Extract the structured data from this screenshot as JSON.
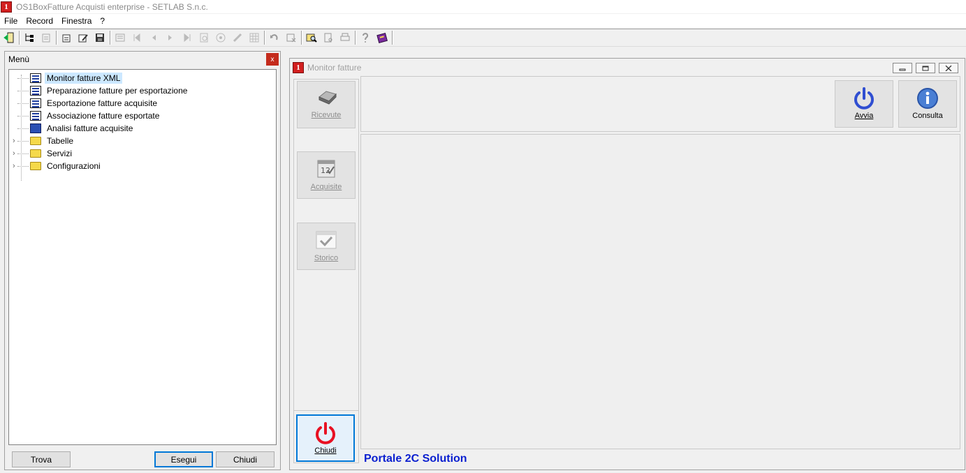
{
  "app": {
    "title": "OS1BoxFatture Acquisti enterprise - SETLAB S.n.c.",
    "icon_glyph": "1"
  },
  "menubar": {
    "items": [
      "File",
      "Record",
      "Finestra",
      "?"
    ]
  },
  "menu_panel": {
    "title": "Menù",
    "close_glyph": "x",
    "tree": [
      {
        "label": "Monitor fatture XML",
        "icon": "form-icon"
      },
      {
        "label": "Preparazione fatture per esportazione",
        "icon": "form-icon"
      },
      {
        "label": "Esportazione fatture acquisite",
        "icon": "form-icon"
      },
      {
        "label": "Associazione fatture esportate",
        "icon": "form-icon"
      },
      {
        "label": "Analisi fatture acquisite",
        "icon": "book-icon"
      },
      {
        "label": "Tabelle",
        "icon": "folder-icon"
      },
      {
        "label": "Servizi",
        "icon": "folder-icon"
      },
      {
        "label": "Configurazioni",
        "icon": "folder-icon"
      }
    ],
    "buttons": {
      "trova": "Trova",
      "esegui": "Esegui",
      "chiudi": "Chiudi"
    }
  },
  "monitor": {
    "title": "Monitor fatture",
    "side": {
      "ricevute": "Ricevute",
      "acquisite": "Acquisite",
      "storico": "Storico",
      "chiudi": "Chiudi"
    },
    "top": {
      "avvia": "Avvia",
      "consulta": "Consulta"
    },
    "footer": "Portale 2C Solution"
  },
  "colors": {
    "accent": "#0078d7",
    "power_red": "#e81123",
    "power_blue": "#2f4ed1",
    "footer_blue": "#0a1fd0"
  }
}
